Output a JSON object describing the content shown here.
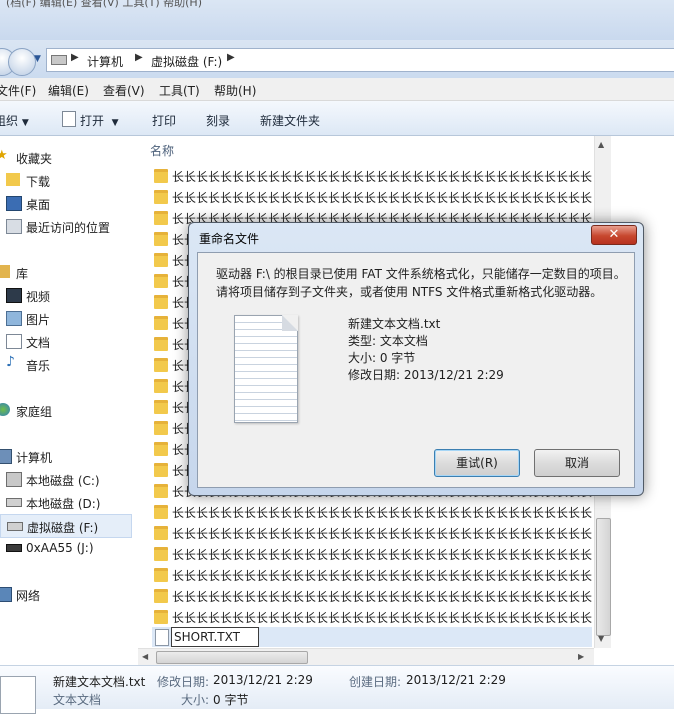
{
  "titlebar": {
    "cut_text": "(档(F)  编辑(E)  查看(V)  工具(T)  帮助(H)"
  },
  "address": {
    "crumbs": [
      "计算机",
      "虚拟磁盘 (F:)"
    ]
  },
  "menu": [
    "文件(F)",
    "编辑(E)",
    "查看(V)",
    "工具(T)",
    "帮助(H)"
  ],
  "commands": {
    "organize": "组织",
    "open": "打开",
    "print": "打印",
    "burn": "刻录",
    "new_folder": "新建文件夹"
  },
  "nav": {
    "favorites": "收藏夹",
    "downloads": "下载",
    "desktop": "桌面",
    "recent": "最近访问的位置",
    "libraries": "库",
    "videos": "视频",
    "pictures": "图片",
    "documents": "文档",
    "music": "音乐",
    "homegroup": "家庭组",
    "computer": "计算机",
    "drive_c": "本地磁盘 (C:)",
    "drive_d": "本地磁盘 (D:)",
    "drive_f": "虚拟磁盘 (F:)",
    "drive_j": "0xAA55 (J:)",
    "network": "网络"
  },
  "files": {
    "column_name": "名称",
    "folder_name": "长长长长长长长长长长长长长长长长长长长长长长长长长长长长长长长长长长长长",
    "rename_value": "SHORT.TXT"
  },
  "details": {
    "name": "新建文本文档.txt",
    "type": "文本文档",
    "modified_label": "修改日期:",
    "modified": "2013/12/21 2:29",
    "size_label": "大小:",
    "size": "0 字节",
    "created_label": "创建日期:",
    "created": "2013/12/21 2:29"
  },
  "dialog": {
    "title": "重命名文件",
    "message": "驱动器 F:\\ 的根目录已使用 FAT 文件系统格式化，只能储存一定数目的项目。请将项目储存到子文件夹，或者使用 NTFS 文件格式重新格式化驱动器。",
    "file_name": "新建文本文档.txt",
    "type": "类型: 文本文档",
    "size": "大小: 0 字节",
    "modified": "修改日期: 2013/12/21 2:29",
    "retry": "重试(R)",
    "cancel": "取消"
  }
}
